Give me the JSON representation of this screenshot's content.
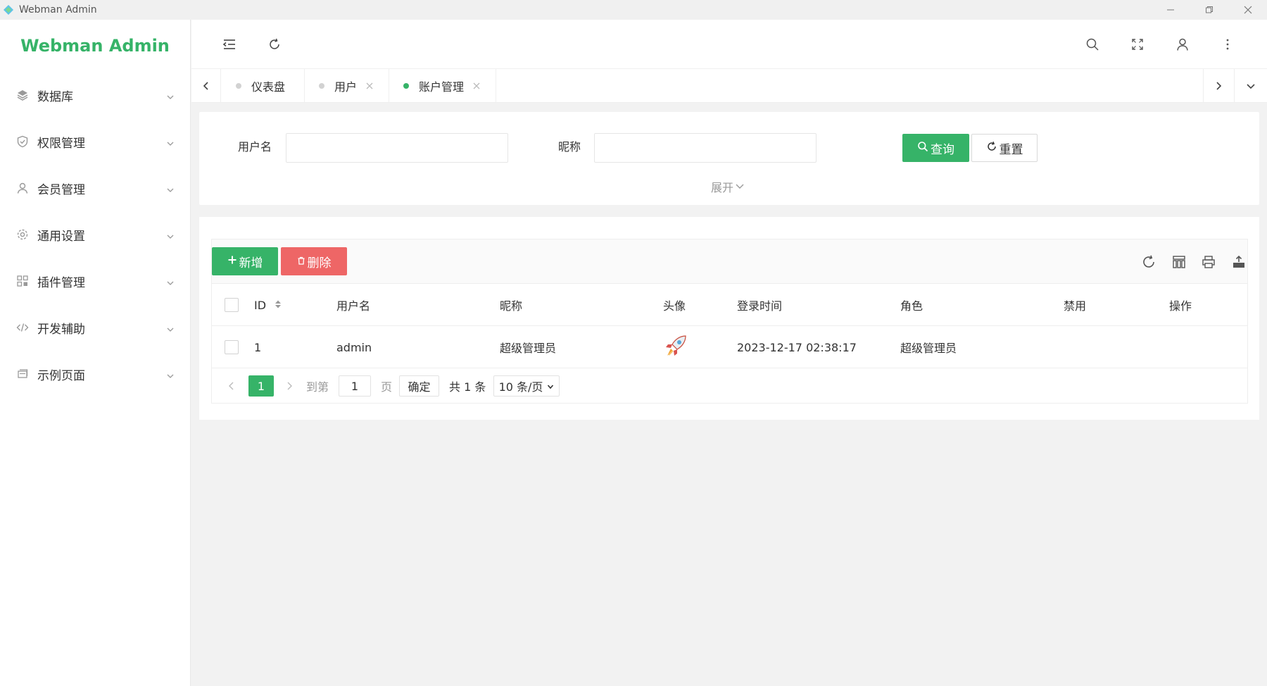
{
  "window": {
    "title": "Webman Admin",
    "controls": [
      "minimize-icon",
      "restore-icon",
      "close-icon"
    ]
  },
  "sidebar": {
    "logo": "Webman Admin",
    "items": [
      {
        "label": "数据库",
        "icon": "layers-icon"
      },
      {
        "label": "权限管理",
        "icon": "shield-check-icon"
      },
      {
        "label": "会员管理",
        "icon": "user-icon"
      },
      {
        "label": "通用设置",
        "icon": "gear-icon"
      },
      {
        "label": "插件管理",
        "icon": "grid-icon"
      },
      {
        "label": "开发辅助",
        "icon": "code-icon"
      },
      {
        "label": "示例页面",
        "icon": "page-icon"
      }
    ]
  },
  "header": {
    "left_icons": [
      "menu-fold-icon",
      "refresh-icon"
    ],
    "right_icons": [
      "search-icon",
      "fullscreen-icon",
      "user-icon",
      "more-vertical-icon"
    ]
  },
  "tabs": [
    {
      "label": "仪表盘",
      "closable": false,
      "active": false
    },
    {
      "label": "用户",
      "closable": true,
      "active": false
    },
    {
      "label": "账户管理",
      "closable": true,
      "active": true
    }
  ],
  "search": {
    "username_label": "用户名",
    "username_value": "",
    "nickname_label": "昵称",
    "nickname_value": "",
    "query_button": "查询",
    "reset_button": "重置",
    "expand_label": "展开"
  },
  "toolbar": {
    "add_button": "新增",
    "delete_button": "删除",
    "right_icons": [
      "refresh-icon",
      "columns-icon",
      "print-icon",
      "export-icon"
    ]
  },
  "table": {
    "columns": [
      "ID",
      "用户名",
      "昵称",
      "头像",
      "登录时间",
      "角色",
      "禁用",
      "操作"
    ],
    "rows": [
      {
        "id": "1",
        "username": "admin",
        "nickname": "超级管理员",
        "avatar": "rocket-icon",
        "login_time": "2023-12-17 02:38:17",
        "role": "超级管理员",
        "disabled": "",
        "actions": ""
      }
    ]
  },
  "pagination": {
    "current_page": "1",
    "goto_label": "到第",
    "goto_value": "1",
    "page_unit": "页",
    "confirm_button": "确定",
    "total_text": "共 1 条",
    "page_size": "10 条/页"
  },
  "colors": {
    "primary": "#36b368",
    "danger": "#ee6666",
    "background": "#f2f2f2"
  }
}
